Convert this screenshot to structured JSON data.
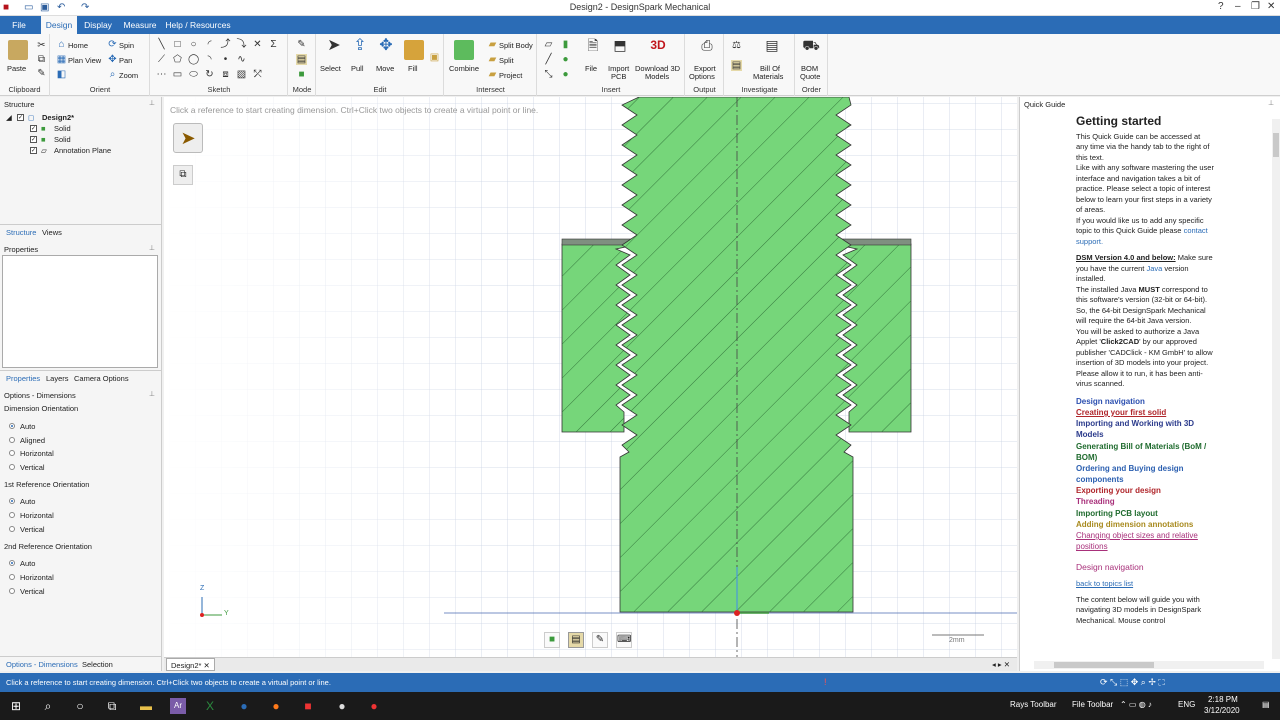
{
  "window": {
    "title": "Design2 - DesignSpark Mechanical"
  },
  "menu": [
    {
      "label": "File"
    },
    {
      "label": "Design"
    },
    {
      "label": "Display"
    },
    {
      "label": "Measure"
    },
    {
      "label": "Help / Resources"
    }
  ],
  "ribbon": {
    "clipboard": {
      "paste": "Paste",
      "group": "Clipboard"
    },
    "orient": {
      "home": "Home",
      "spin": "Spin",
      "plan_view": "Plan View",
      "pan": "Pan",
      "zoom": "Zoom",
      "group": "Orient"
    },
    "sketch": {
      "group": "Sketch"
    },
    "mode": {
      "group": "Mode"
    },
    "edit": {
      "select": "Select",
      "pull": "Pull",
      "move": "Move",
      "fill": "Fill",
      "group": "Edit"
    },
    "intersect": {
      "combine": "Combine",
      "split_body": "Split Body",
      "split": "Split",
      "project": "Project",
      "group": "Intersect"
    },
    "insert": {
      "file": "File",
      "import_pcb_1": "Import",
      "import_pcb_2": "PCB",
      "download_1": "Download 3D",
      "download_2": "Models",
      "group": "Insert"
    },
    "output": {
      "export_1": "Export",
      "export_2": "Options",
      "group": "Output"
    },
    "investigate": {
      "bom_1": "Bill Of",
      "bom_2": "Materials",
      "group": "Investigate"
    },
    "order": {
      "quote_1": "BOM",
      "quote_2": "Quote",
      "group": "Order"
    }
  },
  "structure": {
    "title": "Structure",
    "items": [
      {
        "label": "Design2*"
      },
      {
        "label": "Solid"
      },
      {
        "label": "Solid"
      },
      {
        "label": "Annotation Plane"
      }
    ],
    "tabs": [
      "Structure",
      "Views"
    ]
  },
  "properties": {
    "title": "Properties",
    "tabs": [
      "Properties",
      "Layers",
      "Camera Options"
    ]
  },
  "options": {
    "title": "Options - Dimensions",
    "dimension_orientation": {
      "label": "Dimension Orientation",
      "options": [
        "Auto",
        "Aligned",
        "Horizontal",
        "Vertical"
      ],
      "selected": "Auto"
    },
    "first_ref": {
      "label": "1st Reference Orientation",
      "options": [
        "Auto",
        "Horizontal",
        "Vertical"
      ],
      "selected": "Auto"
    },
    "second_ref": {
      "label": "2nd Reference Orientation",
      "options": [
        "Auto",
        "Horizontal",
        "Vertical"
      ],
      "selected": "Auto"
    },
    "bottom_tabs": [
      "Options - Dimensions",
      "Selection"
    ]
  },
  "canvas": {
    "hint": "Click a reference to start creating dimension. Ctrl+Click two objects to create a virtual point or line.",
    "scale_label": "2mm",
    "axis_z": "Z",
    "axis_y": "Y",
    "doc_tab": "Design2*"
  },
  "quick_guide": {
    "panel_title": "Quick Guide",
    "heading": "Getting started",
    "intro_1": "This Quick Guide can be accessed at any time via the handy tab to the right of this text.",
    "intro_2": "Like with any software mastering the user interface and navigation takes a bit of practice. Please select a topic of interest below to learn your first steps in a variety of areas.",
    "intro_3": "If you would like us to add any specific topic to this Quick Guide please",
    "contact": "contact support.",
    "dsm_label": "DSM Version 4.0 and below:",
    "dsm_1": " Make sure you have the current",
    "java": "Java",
    "dsm_2": " version installed.",
    "java_note_1": "The installed Java",
    "must": "MUST",
    "java_note_2": " correspond to this software's version (32-bit or 64-bit). So, the 64-bit DesignSpark Mechanical will require the 64-bit Java version.",
    "applet_1": "You will be asked to authorize a Java Applet '",
    "applet_name": "Click2CAD",
    "applet_2": "' by our approved publisher 'CADClick - KM GmbH' to allow insertion of 3D models into your project. Please allow it to run, it has been anti-virus scanned.",
    "topics": [
      {
        "label": "Design navigation",
        "color": "#2b4fb0"
      },
      {
        "label": "Creating your first solid",
        "color": "#b0262b"
      },
      {
        "label": "Importing and Working with 3D Models",
        "color": "#2b3b8c"
      },
      {
        "label": "Generating Bill of Materials (BoM / BOM)",
        "color": "#1f6b2e"
      },
      {
        "label": "Ordering and Buying design components",
        "color": "#2b5fb0"
      },
      {
        "label": "Exporting your design",
        "color": "#b0262b"
      },
      {
        "label": "Threading",
        "color": "#a8307a"
      },
      {
        "label": "Importing PCB layout",
        "color": "#1f6b2e"
      },
      {
        "label": "Adding dimension annotations",
        "color": "#a88a1e"
      },
      {
        "label": "Changing object sizes and relative positions",
        "color": "#a8307a"
      }
    ],
    "section_heading": "Design navigation",
    "back_link": "back to topics list",
    "nav_text": "The content below will guide you with navigating 3D models in DesignSpark Mechanical. Mouse control"
  },
  "status": {
    "text": "Click a reference to start creating dimension. Ctrl+Click two objects to create a virtual point or line."
  },
  "taskbar": {
    "rays_toolbar": "Rays Toolbar",
    "file_toolbar": "File Toolbar",
    "lang": "ENG",
    "time": "2:18 PM",
    "date": "3/12/2020"
  },
  "colors": {
    "accent": "#2b6cb6",
    "solid": "#76d67a",
    "hatch": "#2e6e36"
  }
}
